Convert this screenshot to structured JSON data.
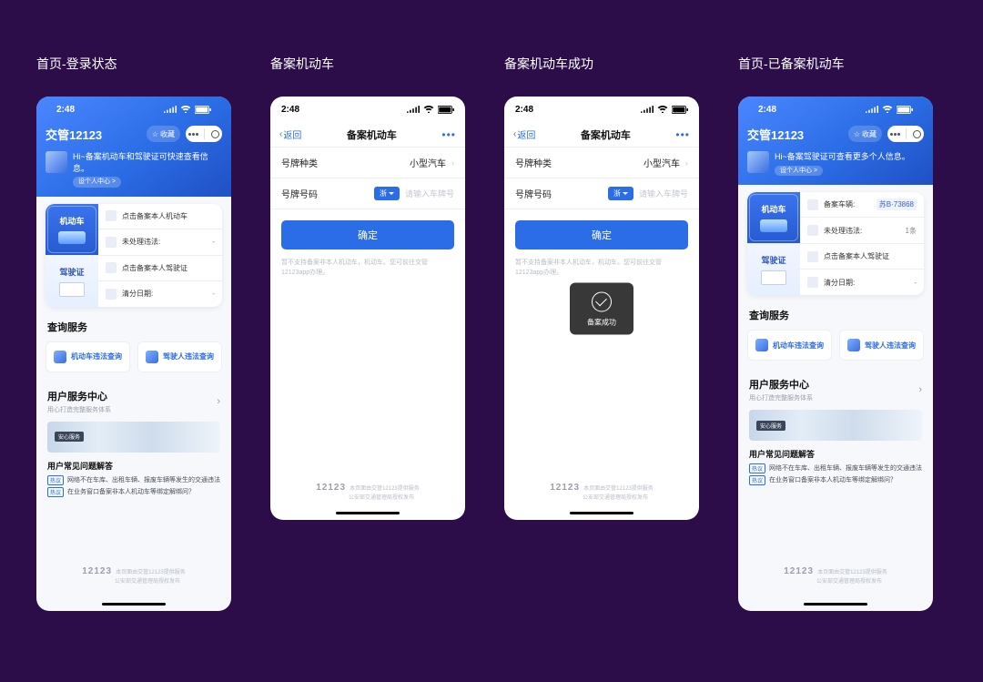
{
  "status": {
    "time": "2:48"
  },
  "columns": [
    {
      "title": "首页-登录状态"
    },
    {
      "title": "备案机动车"
    },
    {
      "title": "备案机动车成功"
    },
    {
      "title": "首页-已备案机动车"
    }
  ],
  "home": {
    "appTitle": "交管12123",
    "fav": "收藏",
    "greetA": "Hi~备案机动车和驾驶证可快速查看信息。",
    "greetB": "Hi~备案驾驶证可查看更多个人信息。",
    "profileLink": "设个人中心 >",
    "vehicle": {
      "label": "机动车",
      "item1": "点击备案本人机动车",
      "item1b_label": "备案车辆:",
      "item1b_val": "苏B·73868",
      "item2_label": "未处理违法:",
      "item2_val": "-",
      "item2b_val": "1条"
    },
    "license": {
      "label": "驾驶证",
      "item1": "点击备案本人驾驶证",
      "item2_label": "清分日期:",
      "item2_val": "-"
    },
    "querySection": "查询服务",
    "query1": "机动车违法查询",
    "query2": "驾驶人违法查询",
    "serviceCenter": "用户服务中心",
    "serviceSub": "用心打造完整服务体系",
    "bannerTag": "安心服务",
    "faqTitle": "用户常见问题解答",
    "faqBadge": "热议",
    "faq1": "网络不在车库、出租车辆、报废车辆等发生的交通违法…",
    "faq2": "在业务窗口备案非本人机动车等绑定解绑问？",
    "footer1": "本页面由交管12123提供服务",
    "footer2": "公安部交通管理局授权发布",
    "footerLogo": "12123"
  },
  "register": {
    "back": "返回",
    "title": "备案机动车",
    "row1_label": "号牌种类",
    "row1_val": "小型汽车",
    "row2_label": "号牌号码",
    "province": "浙",
    "placeholder": "请输入车牌号",
    "submit": "确定",
    "hint": "暂不支持备案非本人机动车，机动车。您可前往交管12123app办理。"
  },
  "toast": {
    "text": "备案成功"
  }
}
